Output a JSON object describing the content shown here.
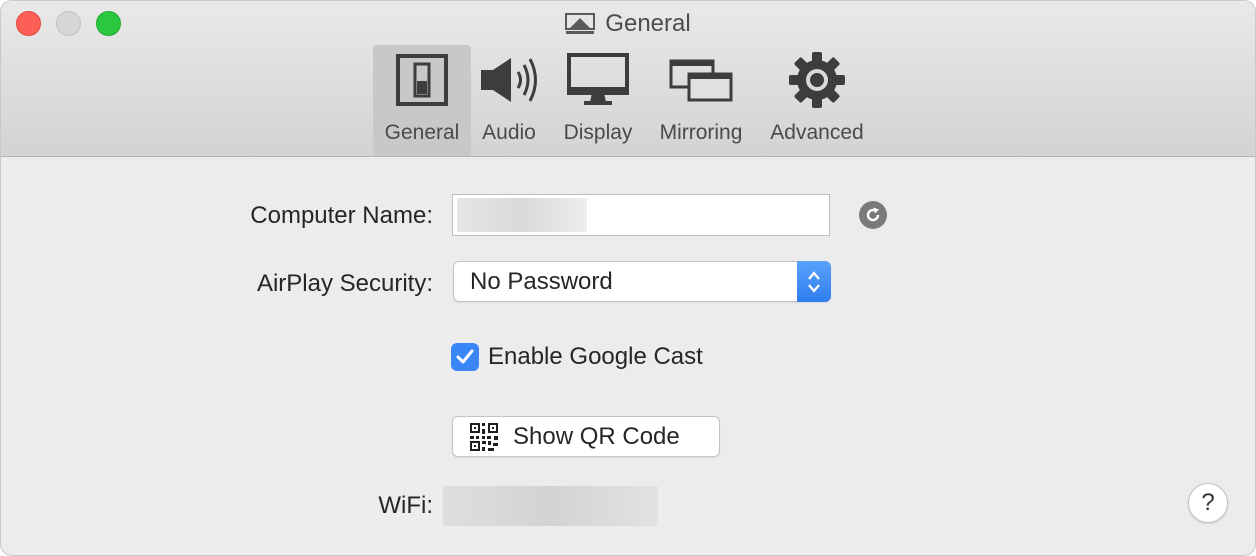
{
  "window": {
    "title": "General"
  },
  "toolbar": {
    "tabs": [
      {
        "label": "General",
        "icon": "general-switch-icon",
        "active": true
      },
      {
        "label": "Audio",
        "icon": "speaker-icon",
        "active": false
      },
      {
        "label": "Display",
        "icon": "monitor-icon",
        "active": false
      },
      {
        "label": "Mirroring",
        "icon": "mirroring-icon",
        "active": false
      },
      {
        "label": "Advanced",
        "icon": "gear-icon",
        "active": false
      }
    ]
  },
  "form": {
    "computer_name_label": "Computer Name:",
    "computer_name_value": "",
    "airplay_security_label": "AirPlay Security:",
    "airplay_security_value": "No Password",
    "google_cast_label": "Enable Google Cast",
    "google_cast_checked": true,
    "qr_button_label": "Show QR Code",
    "wifi_label": "WiFi:",
    "wifi_value": "",
    "help_label": "?"
  },
  "colors": {
    "accent": "#3a86f7",
    "close": "#fd5f57",
    "zoom": "#2bc73f"
  }
}
